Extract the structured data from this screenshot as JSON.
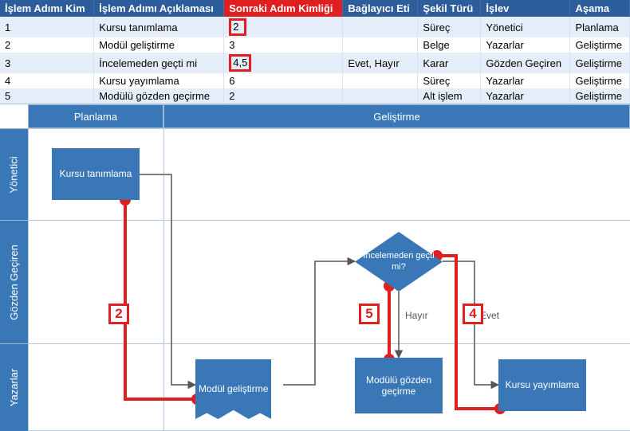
{
  "table": {
    "headers": [
      "İşlem Adımı Kim",
      "İşlem Adımı Açıklaması",
      "Sonraki Adım Kimliği",
      "Bağlayıcı Eti",
      "Şekil Türü",
      "İşlev",
      "Aşama"
    ],
    "rows": [
      {
        "id": "1",
        "desc": "Kursu tanımlama",
        "next": "2",
        "next_hl": true,
        "conn": "",
        "shape": "Süreç",
        "func": "Yönetici",
        "phase": "Planlama"
      },
      {
        "id": "2",
        "desc": "Modül geliştirme",
        "next": "3",
        "next_hl": false,
        "conn": "",
        "shape": "Belge",
        "func": "Yazarlar",
        "phase": "Geliştirme"
      },
      {
        "id": "3",
        "desc": "İncelemeden geçti mi",
        "next": "4,5",
        "next_hl": true,
        "conn": "Evet, Hayır",
        "shape": "Karar",
        "func": "Gözden Geçiren",
        "phase": "Geliştirme"
      },
      {
        "id": "4",
        "desc": "Kursu yayımlama",
        "next": "6",
        "next_hl": false,
        "conn": "",
        "shape": "Süreç",
        "func": "Yazarlar",
        "phase": "Geliştirme"
      },
      {
        "id": "5",
        "desc": "Modülü gözden geçirme",
        "next": "2",
        "next_hl": false,
        "conn": "",
        "shape": "Alt işlem",
        "func": "Yazarlar",
        "phase": "Geliştirme"
      }
    ]
  },
  "phases": {
    "p1": "Planlama",
    "p2": "Geliştirme"
  },
  "lanes": {
    "a": "Yönetici",
    "b": "Gözden Geçiren",
    "c": "Yazarlar"
  },
  "shapes": {
    "s1": "Kursu tanımlama",
    "s2": "Modül geliştirme",
    "s3": "İncelemeden geçti mi?",
    "s4": "Kursu yayımlama",
    "s5": "Modülü gözden geçirme"
  },
  "edges": {
    "no": "Hayır",
    "yes": "Evet"
  },
  "annotations": {
    "a2": "2",
    "a5": "5",
    "a4": "4"
  }
}
